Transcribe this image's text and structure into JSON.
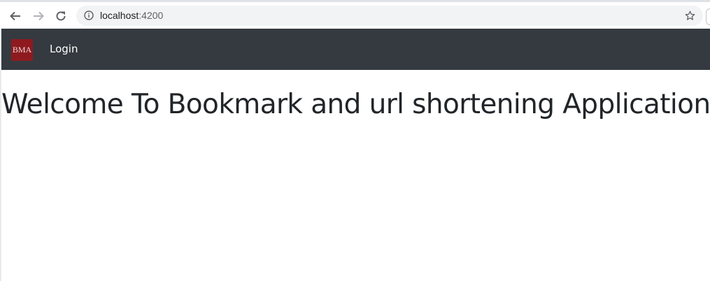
{
  "browser": {
    "url_host": "localhost",
    "url_port": ":4200",
    "icons": {
      "back": "arrow-left-icon",
      "forward": "arrow-right-icon",
      "reload": "reload-icon",
      "info": "info-icon",
      "bookmark": "star-icon"
    }
  },
  "navbar": {
    "brand_text": "BMA",
    "login_label": "Login",
    "colors": {
      "background": "#343a40",
      "brand": "#8e1a1f"
    }
  },
  "main": {
    "title": "Welcome To Bookmark and url shortening Application!"
  }
}
